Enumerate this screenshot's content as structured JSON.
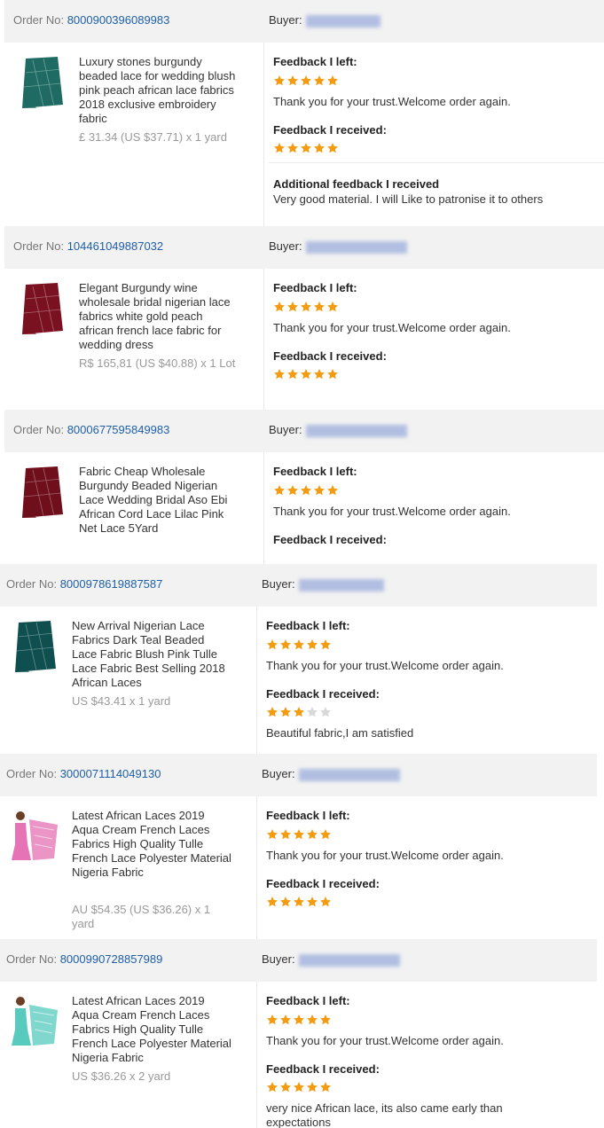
{
  "labels": {
    "order_no": "Order No:",
    "buyer": "Buyer:",
    "feedback_left": "Feedback I left:",
    "feedback_received": "Feedback I received:",
    "additional_feedback": "Additional feedback I received"
  },
  "colors": {
    "star_filled": "#f39c12",
    "star_empty": "#d8d8d8",
    "order_number": "#1f5fa8"
  },
  "orders": [
    {
      "order_number": "8000900396089983",
      "product": "Luxury stones burgundy beaded lace for wedding blush pink peach african lace fabrics 2018 exclusive embroidery fabric",
      "price": "£ 31.34 (US $37.71) x 1 yard",
      "thumb_color": "#1f6b63",
      "feedback_left_rating": 5,
      "feedback_left_text": "Thank you for your trust.Welcome order again.",
      "feedback_received_rating": 5,
      "feedback_received_text": "",
      "additional_feedback": "Very good material. I will Like to patronise it to others"
    },
    {
      "order_number": "104461049887032",
      "product": "Elegant Burgundy wine wholesale bridal nigerian lace fabrics white gold peach african french lace fabric for wedding dress",
      "price": "R$ 165,81 (US $40.88) x 1 Lot",
      "thumb_color": "#7a1120",
      "feedback_left_rating": 5,
      "feedback_left_text": "Thank you for your trust.Welcome order again.",
      "feedback_received_rating": 5,
      "feedback_received_text": ""
    },
    {
      "order_number": "8000677595849983",
      "product": "Fabric Cheap Wholesale Burgundy Beaded Nigerian Lace Wedding Bridal Aso Ebi African Cord Lace Lilac Pink Net Lace 5Yard",
      "price": "",
      "thumb_color": "#6e0f1b",
      "feedback_left_rating": 5,
      "feedback_left_text": "Thank you for your trust.Welcome order again.",
      "feedback_received_rating": null,
      "feedback_received_text": ""
    },
    {
      "order_number": "8000978619887587",
      "product": "New Arrival Nigerian Lace Fabrics Dark Teal Beaded Lace Fabric Blush Pink Tulle Lace Fabric Best Selling 2018 African Laces",
      "price": "US $43.41 x 1 yard",
      "thumb_color": "#0f4f4f",
      "feedback_left_rating": 5,
      "feedback_left_text": "Thank you for your trust.Welcome order again.",
      "feedback_received_rating": 3,
      "feedback_received_text": "Beautiful fabric,I am satisfied"
    },
    {
      "order_number": "3000071114049130",
      "product": "Latest African Laces 2019 Aqua Cream French Laces Fabrics High Quality Tulle French Lace Polyester Material Nigeria Fabric",
      "price": "AU $54.35 (US $36.26) x 1 yard",
      "thumb_color": "#e05aa8",
      "feedback_left_rating": 5,
      "feedback_left_text": "Thank you for your trust.Welcome order again.",
      "feedback_received_rating": 5,
      "feedback_received_text": ""
    },
    {
      "order_number": "8000990728857989",
      "product": "Latest African Laces 2019 Aqua Cream French Laces Fabrics High Quality Tulle French Lace Polyester Material Nigeria Fabric",
      "price": "US $36.26 x 2 yard",
      "thumb_color": "#3cc2b3",
      "feedback_left_rating": 5,
      "feedback_left_text": "Thank you for your trust.Welcome order again.",
      "feedback_received_rating": 5,
      "feedback_received_text": "very nice African lace, its also came early than expectations"
    }
  ]
}
